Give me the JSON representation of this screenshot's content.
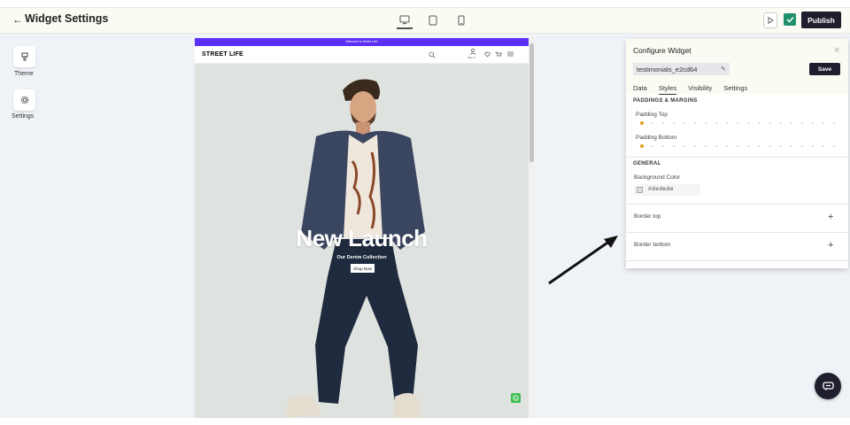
{
  "header": {
    "back_glyph": "←",
    "title": "Widget Settings",
    "publish_label": "Publish"
  },
  "sidebar": {
    "items": [
      {
        "label": "Theme",
        "icon": "brush-icon"
      },
      {
        "label": "Settings",
        "icon": "gear-icon"
      }
    ]
  },
  "preview": {
    "announcement": "Welcome to Street Life!",
    "logo": "STREET LIFE",
    "account_label": "Sign In",
    "hero_title": "New Launch",
    "hero_subtitle": "Our Denim Collection",
    "cta_label": "Shop Now"
  },
  "panel": {
    "title": "Configure Widget",
    "widget_id": "testimonials_e2cd64",
    "save_label": "Save",
    "tabs": [
      {
        "label": "Data"
      },
      {
        "label": "Styles"
      },
      {
        "label": "Visibility"
      },
      {
        "label": "Settings"
      }
    ],
    "active_tab": "Styles",
    "section_padding": "PADDINGS & MARGINS",
    "padding_top_label": "Padding Top",
    "padding_bottom_label": "Padding Bottom",
    "padding_top_value": 0,
    "padding_bottom_value": 0,
    "section_general": "GENERAL",
    "bg_color_label": "Background Color",
    "bg_color_value": "#dedede",
    "border_top_label": "Border top",
    "border_bottom_label": "Border bottom"
  },
  "colors": {
    "accent": "#1e1e2e",
    "announcement_bar": "#5b2ff5",
    "check": "#1f8f6b",
    "slider_dot": "#e0a020",
    "whatsapp": "#3fbf53"
  }
}
